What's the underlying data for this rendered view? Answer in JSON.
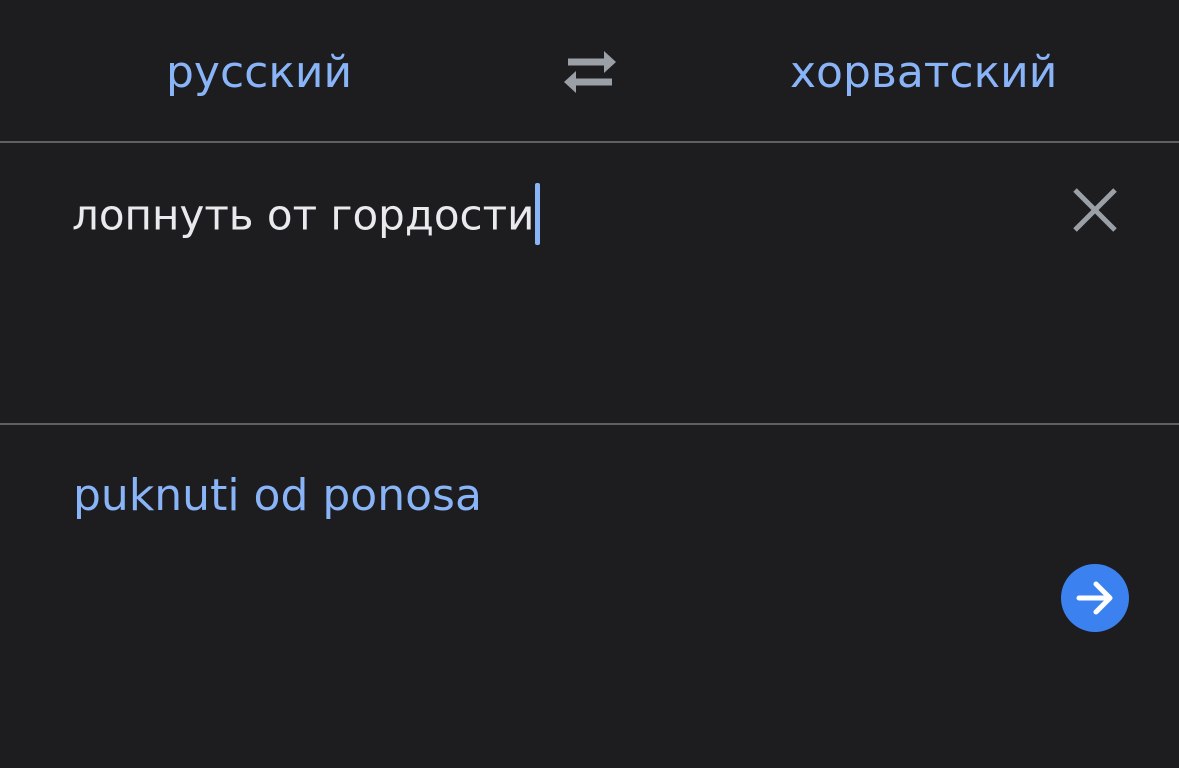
{
  "languages": {
    "source": "русский",
    "target": "хорватский",
    "swap_icon": "swap-arrows-icon"
  },
  "input": {
    "text": "лопнуть от гордости",
    "clear_icon": "close-icon"
  },
  "output": {
    "text": "puknuti od ponosa",
    "go_icon": "arrow-right-icon"
  },
  "colors": {
    "background": "#1d1d20",
    "accent": "#8ab4f8",
    "text": "#e8eaed",
    "divider": "#5f6064",
    "button": "#3b82f0",
    "icon": "#9aa0a6"
  }
}
